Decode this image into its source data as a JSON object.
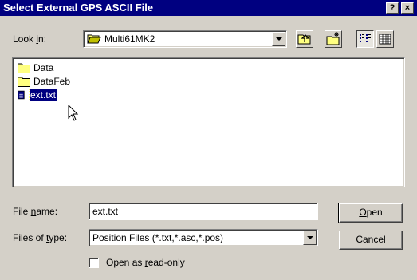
{
  "window": {
    "title": "Select External GPS ASCII File",
    "help_label": "?",
    "close_label": "×"
  },
  "lookin": {
    "label_pre": "Look ",
    "label_ul": "i",
    "label_post": "n:",
    "value": "Multi61MK2",
    "icon": "folder-open-icon"
  },
  "toolbar": {
    "up_icon": "up-folder-icon",
    "new_folder_icon": "new-folder-icon",
    "list_view_icon": "list-view-icon",
    "details_view_icon": "details-view-icon",
    "active_view": "list"
  },
  "files": [
    {
      "name": "Data",
      "type": "folder",
      "selected": false
    },
    {
      "name": "DataFeb",
      "type": "folder",
      "selected": false
    },
    {
      "name": "ext.txt",
      "type": "text-file",
      "selected": true
    }
  ],
  "filename": {
    "label_pre": "File ",
    "label_ul": "n",
    "label_post": "ame:",
    "value": "ext.txt"
  },
  "filetype": {
    "label_pre": "Files of ",
    "label_ul": "t",
    "label_post": "ype:",
    "value": "Position Files (*.txt,*.asc,*.pos)"
  },
  "buttons": {
    "open_ul": "O",
    "open_rest": "pen",
    "cancel": "Cancel"
  },
  "readonly": {
    "label_pre": "Open as ",
    "label_ul": "r",
    "label_post": "ead-only",
    "checked": false
  }
}
